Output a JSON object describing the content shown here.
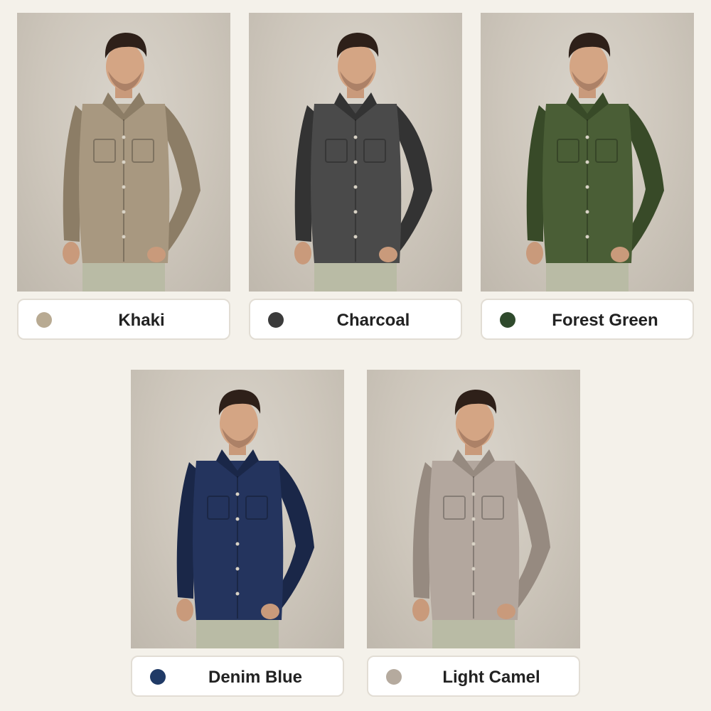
{
  "variants": [
    {
      "name": "Khaki",
      "swatch": "#b8aa92",
      "shirt": "#a89880",
      "shirt_dark": "#8c7d66"
    },
    {
      "name": "Charcoal",
      "swatch": "#3b3b3b",
      "shirt": "#4a4a4a",
      "shirt_dark": "#333333"
    },
    {
      "name": "Forest Green",
      "swatch": "#2f4a2c",
      "shirt": "#4a5e36",
      "shirt_dark": "#384a28"
    },
    {
      "name": "Denim Blue",
      "swatch": "#203a66",
      "shirt": "#24345e",
      "shirt_dark": "#1a2748"
    },
    {
      "name": "Light Camel",
      "swatch": "#b5aa9e",
      "shirt": "#b3a79e",
      "shirt_dark": "#968a80"
    }
  ]
}
